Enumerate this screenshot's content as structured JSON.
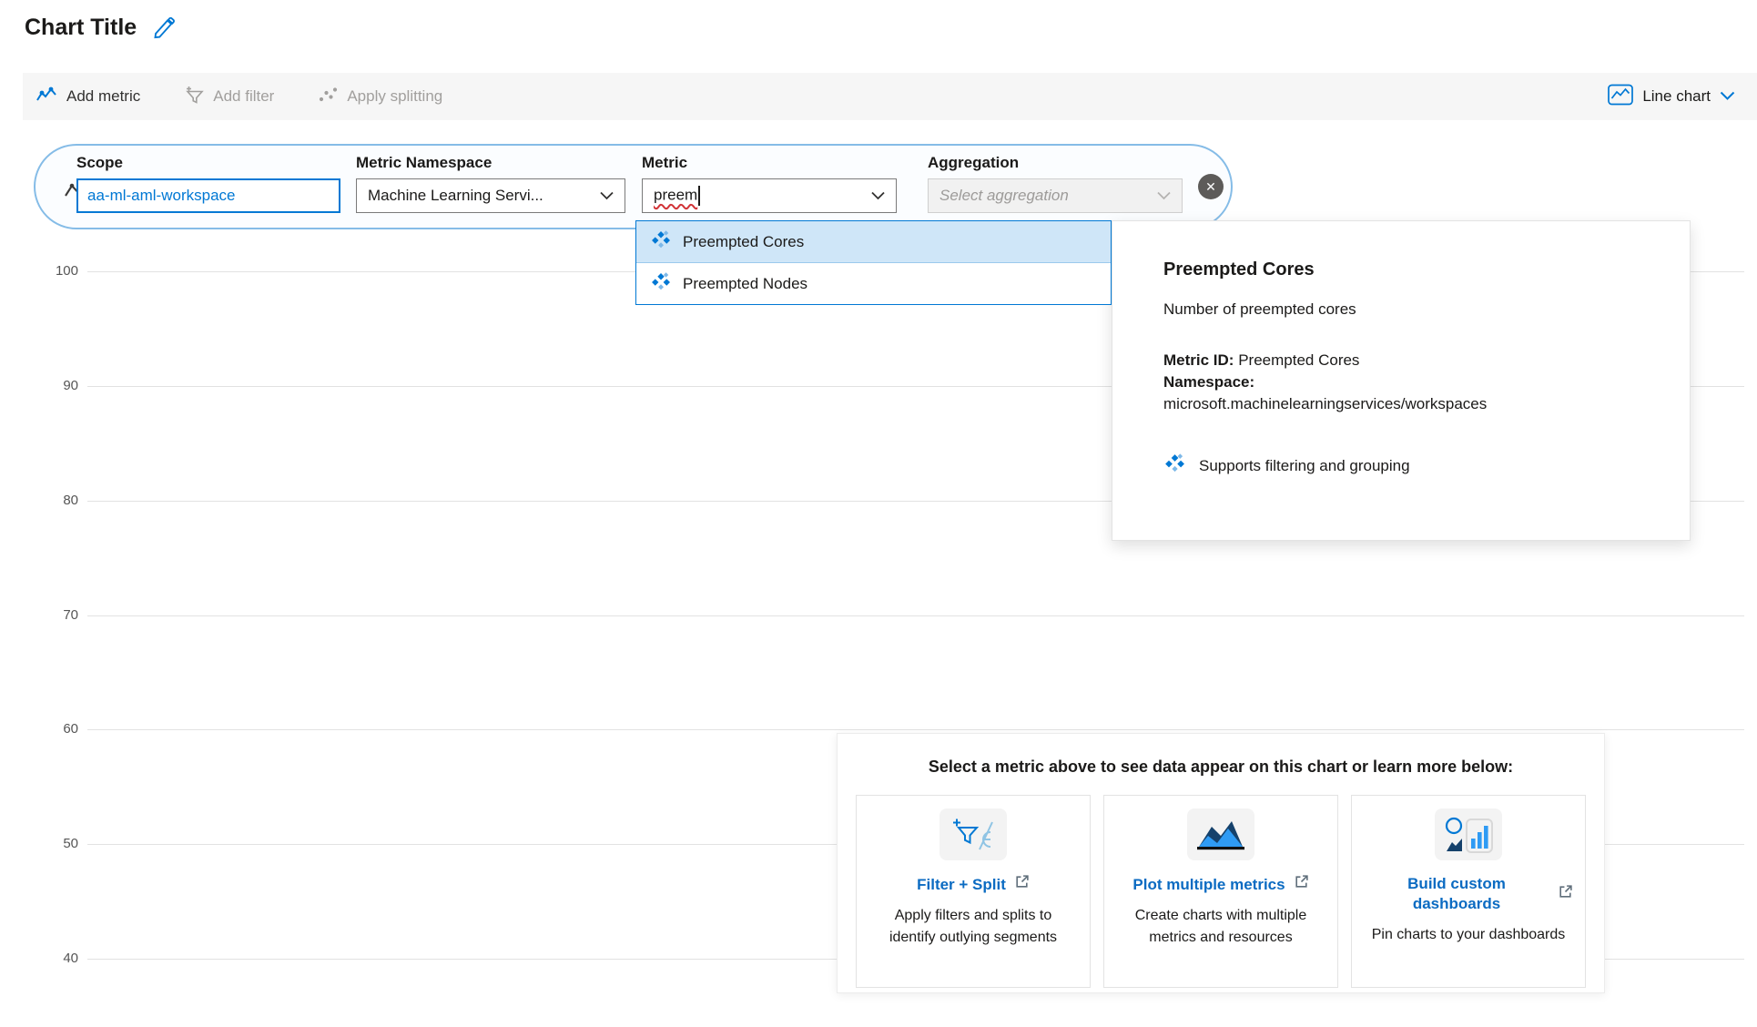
{
  "page": {
    "title": "Chart Title"
  },
  "toolbar": {
    "add_metric": "Add metric",
    "add_filter": "Add filter",
    "apply_splitting": "Apply splitting",
    "chart_type": "Line chart"
  },
  "metric_picker": {
    "scope_label": "Scope",
    "scope_value": "aa-ml-aml-workspace",
    "namespace_label": "Metric Namespace",
    "namespace_value": "Machine Learning Servi...",
    "metric_label": "Metric",
    "metric_value": "preem",
    "aggregation_label": "Aggregation",
    "aggregation_placeholder": "Select aggregation"
  },
  "metric_dropdown": {
    "options": [
      {
        "label": "Preempted Cores"
      },
      {
        "label": "Preempted Nodes"
      }
    ]
  },
  "metric_details": {
    "title": "Preempted Cores",
    "description": "Number of preempted cores",
    "metric_id_label": "Metric ID:",
    "metric_id_value": "Preempted Cores",
    "namespace_label": "Namespace:",
    "namespace_value": "microsoft.machinelearningservices/workspaces",
    "capability": "Supports filtering and grouping"
  },
  "chart": {
    "y_ticks": [
      "100",
      "90",
      "80",
      "70",
      "60",
      "50",
      "40"
    ]
  },
  "empty_state": {
    "title": "Select a metric above to see data appear on this chart or learn more below:",
    "cards": [
      {
        "title": "Filter + Split",
        "description": "Apply filters and splits to identify outlying segments"
      },
      {
        "title": "Plot multiple metrics",
        "description": "Create charts with multiple metrics and resources"
      },
      {
        "title": "Build custom dashboards",
        "description": "Pin charts to your dashboards"
      }
    ]
  }
}
